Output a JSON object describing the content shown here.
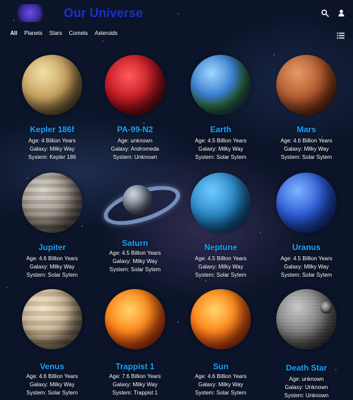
{
  "header": {
    "title": "Our Universe",
    "icons": [
      "logo-icon",
      "search-icon",
      "user-icon"
    ]
  },
  "nav": {
    "tabs": [
      "All",
      "Planets",
      "Stars",
      "Comets",
      "Asteroids"
    ],
    "active_tab": "All",
    "view_toggle_icon": "list-icon"
  },
  "cards": [
    {
      "name": "Kepler 186f",
      "age": "Age: 4 Billion Years",
      "galaxy": "Galaxy: Milky Way",
      "system": "System: Kepler 186",
      "icon": "kepler-186f-planet-icon"
    },
    {
      "name": "PA-99-N2",
      "age": "Age: unknown",
      "galaxy": "Galaxy: Andromeda",
      "system": "System: Unknown",
      "icon": "pa-99-n2-planet-icon"
    },
    {
      "name": "Earth",
      "age": "Age: 4.5 Billion Years",
      "galaxy": "Galaxy: Milky Way",
      "system": "System: Solar Sytem",
      "icon": "earth-planet-icon"
    },
    {
      "name": "Mars",
      "age": "Age: 4.6 Billion Years",
      "galaxy": "Galaxy: Milky Way",
      "system": "System: Solar Sytem",
      "icon": "mars-planet-icon"
    },
    {
      "name": "Jupiter",
      "age": "Age: 4.6 Billion Years",
      "galaxy": "Galaxy: Milky Way",
      "system": "System: Solar Sytem",
      "icon": "jupiter-planet-icon"
    },
    {
      "name": "Saturn",
      "age": "Age: 4.5 Billion Years",
      "galaxy": "Galaxy: Milky Way",
      "system": "System: Solar Sytem",
      "icon": "saturn-planet-icon"
    },
    {
      "name": "Neptune",
      "age": "Age: 4.5 Billion Years",
      "galaxy": "Galaxy: Milky Way",
      "system": "System: Solar Sytem",
      "icon": "neptune-planet-icon"
    },
    {
      "name": "Uranus",
      "age": "Age: 4.5 Billion Years",
      "galaxy": "Galaxy: Milky Way",
      "system": "System: Solar Sytem",
      "icon": "uranus-planet-icon"
    },
    {
      "name": "Venus",
      "age": "Age: 4.6 Billion Years",
      "galaxy": "Galaxy: Milky Way",
      "system": "System: Solar Sytem",
      "icon": "venus-planet-icon"
    },
    {
      "name": "Trappist 1",
      "age": "Age: 7.6 Billion Years",
      "galaxy": "Galaxy: Milky Way",
      "system": "System: Trappist 1",
      "icon": "trappist-1-star-icon"
    },
    {
      "name": "Sun",
      "age": "Age: 4.6 Billion Years",
      "galaxy": "Galaxy: Milky Way",
      "system": "System: Solar Sytem",
      "icon": "sun-star-icon"
    },
    {
      "name": "Death Star",
      "age": "Age: unknown",
      "galaxy": "Galaxy: Unknown",
      "system": "System: Unknown",
      "icon": "death-star-icon"
    }
  ],
  "colors": {
    "title": "#1a2fd1",
    "card_name": "#17a6ff",
    "background": "#0b1428",
    "text": "#ffffff"
  }
}
